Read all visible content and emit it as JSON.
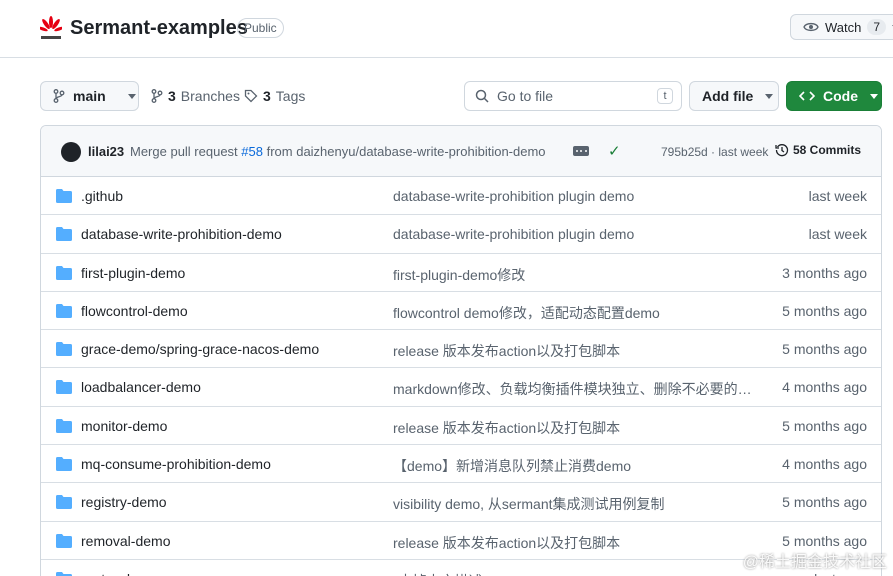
{
  "repo": {
    "name": "Sermant-examples",
    "visibility": "Public",
    "watch_label": "Watch",
    "watch_count": "7"
  },
  "toolbar": {
    "branch": "main",
    "branches_count": "3",
    "branches_label": "Branches",
    "tags_count": "3",
    "tags_label": "Tags",
    "search_placeholder": "Go to file",
    "search_shortcut": "t",
    "add_file_label": "Add file",
    "code_label": "Code"
  },
  "last_commit": {
    "author": "lilai23",
    "message_prefix": "Merge pull request ",
    "pr_link": "#58",
    "message_suffix": " from daizhenyu/database-write-prohibition-demo",
    "sha_time": "795b25d · last week",
    "commits_label": "58 Commits"
  },
  "files": [
    {
      "name": ".github",
      "message": "database-write-prohibition plugin demo",
      "time": "last week"
    },
    {
      "name": "database-write-prohibition-demo",
      "message": "database-write-prohibition plugin demo",
      "time": "last week"
    },
    {
      "name": "first-plugin-demo",
      "message": "first-plugin-demo修改",
      "time": "3 months ago"
    },
    {
      "name": "flowcontrol-demo",
      "message": "flowcontrol demo修改，适配动态配置demo",
      "time": "5 months ago"
    },
    {
      "name": "grace-demo/spring-grace-nacos-demo",
      "message": "release 版本发布action以及打包脚本",
      "time": "5 months ago"
    },
    {
      "name": "loadbalancer-demo",
      "message": "markdown修改、负载均衡插件模块独立、删除不必要的去源...",
      "time": "4 months ago"
    },
    {
      "name": "monitor-demo",
      "message": "release 版本发布action以及打包脚本",
      "time": "5 months ago"
    },
    {
      "name": "mq-consume-prohibition-demo",
      "message": "【demo】新增消息队列禁止消费demo",
      "time": "4 months ago"
    },
    {
      "name": "registry-demo",
      "message": "visibility demo, 从sermant集成测试用例复制",
      "time": "5 months ago"
    },
    {
      "name": "removal-demo",
      "message": "release 版本发布action以及打包脚本",
      "time": "5 months ago"
    },
    {
      "name": "router-demo",
      "message": "*去掉中文描述",
      "time": "last year"
    }
  ],
  "watermark": "@稀土掘金技术社区",
  "colors": {
    "folder": "#54aeff",
    "code_button": "#1f883d",
    "link": "#0969da"
  }
}
